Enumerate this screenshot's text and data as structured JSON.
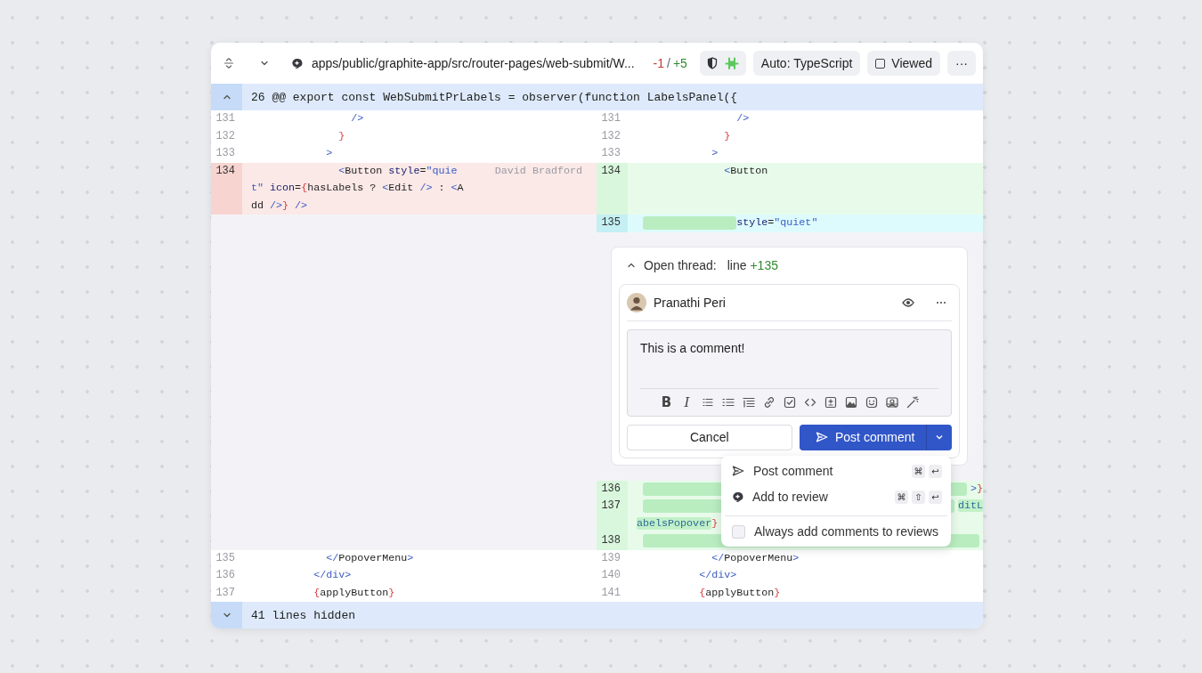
{
  "file_header": {
    "path": "apps/public/graphite-app/src/router-pages/web-submit/W...",
    "deletions": "-1",
    "separator": "/",
    "additions": "+5",
    "language_button": "Auto: TypeScript",
    "viewed": {
      "label": "Viewed",
      "checked": false
    },
    "more": "···"
  },
  "hunk_header": {
    "text": "26 @@ export const WebSubmitPrLabels = observer(function LabelsPanel({",
    "expanded": true
  },
  "pairs": [
    {
      "left": {
        "kind": "context",
        "number": "131",
        "rows": [
          {
            "tokens": [
              {
                "t": "                />",
                "kind": "tag"
              }
            ]
          }
        ]
      },
      "right": {
        "kind": "context",
        "number": "131",
        "rows": [
          {
            "tokens": [
              {
                "t": "                />",
                "kind": "tag"
              }
            ]
          }
        ]
      }
    },
    {
      "left": {
        "kind": "context",
        "number": "132",
        "rows": [
          {
            "tokens": [
              {
                "t": "              }",
                "kind": "brace"
              }
            ]
          }
        ]
      },
      "right": {
        "kind": "context",
        "number": "132",
        "rows": [
          {
            "tokens": [
              {
                "t": "              }",
                "kind": "brace"
              }
            ]
          }
        ]
      }
    },
    {
      "left": {
        "kind": "context",
        "number": "133",
        "rows": [
          {
            "tokens": [
              {
                "t": "            >",
                "kind": "tag"
              }
            ]
          }
        ]
      },
      "right": {
        "kind": "context",
        "number": "133",
        "rows": [
          {
            "tokens": [
              {
                "t": "            >",
                "kind": "tag"
              }
            ]
          }
        ]
      }
    },
    {
      "left": {
        "kind": "removed",
        "number": "134",
        "blame": "David Bradford",
        "rows": [
          {
            "tokens": [
              {
                "t": "              <",
                "kind": "tag"
              },
              {
                "t": "Button ",
                "kind": "text"
              },
              {
                "t": "style",
                "kind": "attr"
              },
              {
                "t": "=",
                "kind": "text"
              },
              {
                "t": "\"quie",
                "kind": "str"
              }
            ]
          },
          {
            "tokens": [
              {
                "t": "t\" ",
                "kind": "str"
              },
              {
                "t": "icon",
                "kind": "attr"
              },
              {
                "t": "=",
                "kind": "text"
              },
              {
                "t": "{",
                "kind": "brace"
              },
              {
                "t": "hasLabels ? ",
                "kind": "text"
              },
              {
                "t": "<",
                "kind": "tag"
              },
              {
                "t": "Edit ",
                "kind": "text"
              },
              {
                "t": "/>",
                "kind": "tag"
              },
              {
                "t": " : ",
                "kind": "text"
              },
              {
                "t": "<",
                "kind": "tag"
              },
              {
                "t": "A",
                "kind": "text"
              }
            ]
          },
          {
            "tokens": [
              {
                "t": "dd ",
                "kind": "text"
              },
              {
                "t": "/>",
                "kind": "tag"
              },
              {
                "t": "}",
                "kind": "brace"
              },
              {
                "t": " />",
                "kind": "tag"
              }
            ]
          }
        ]
      },
      "right": {
        "kind": "added",
        "number": "134",
        "rows": [
          {
            "tokens": [
              {
                "t": "              <",
                "kind": "tag"
              },
              {
                "t": "Button",
                "kind": "text"
              }
            ]
          }
        ]
      }
    },
    {
      "left": {
        "kind": "gap"
      },
      "right": {
        "kind": "current",
        "number": "135",
        "rows": [
          {
            "kind": "indent",
            "tokens": [
              {
                "t": "style",
                "kind": "attr"
              },
              {
                "t": "=",
                "kind": "text"
              },
              {
                "t": "\"quiet\"",
                "kind": "str"
              }
            ]
          }
        ]
      }
    },
    {
      "left": {
        "kind": "gap"
      },
      "right": {
        "kind": "thread",
        "title": "Open thread:",
        "line_label": "line",
        "line_ref": "+135",
        "expanded": true,
        "comment": {
          "author": "Pranathi Peri",
          "text": "This is a comment!",
          "format_buttons": [
            "B",
            "I"
          ],
          "cancel": "Cancel",
          "submit": "Post comment"
        },
        "menu": [
          {
            "kind": "action",
            "label": "Post comment",
            "keys": [
              "⌘",
              "↩"
            ]
          },
          {
            "kind": "action",
            "label": "Add to review",
            "keys": [
              "⌘",
              "⇧",
              "↩"
            ]
          },
          {
            "kind": "checkbox",
            "label": "Always add comments to reviews",
            "checked": false
          }
        ]
      }
    },
    {
      "left": {
        "kind": "gap"
      },
      "right": {
        "kind": "added",
        "number": "136",
        "rows": [
          {
            "kind": "fill",
            "tokens": [
              {
                "t": ">",
                "kind": "tag"
              },
              {
                "t": "}",
                "kind": "brace"
              }
            ]
          }
        ]
      }
    },
    {
      "left": {
        "kind": "gap"
      },
      "right": {
        "kind": "added",
        "number": "137",
        "rows": [
          {
            "kind": "fill",
            "tokens": [
              {
                "t": "ditL",
                "kind": "hl"
              }
            ]
          },
          {
            "tokens": [
              {
                "t": "abelsPopover",
                "kind": "hl"
              },
              {
                "t": "}",
                "kind": "brace"
              }
            ]
          }
        ]
      }
    },
    {
      "left": {
        "kind": "gap"
      },
      "right": {
        "kind": "added",
        "number": "138",
        "rows": [
          {
            "kind": "fill"
          }
        ]
      }
    },
    {
      "left": {
        "kind": "context",
        "number": "135",
        "rows": [
          {
            "tokens": [
              {
                "t": "            </",
                "kind": "tag"
              },
              {
                "t": "PopoverMenu",
                "kind": "text"
              },
              {
                "t": ">",
                "kind": "tag"
              }
            ]
          }
        ]
      },
      "right": {
        "kind": "context",
        "number": "139",
        "rows": [
          {
            "tokens": [
              {
                "t": "            </",
                "kind": "tag"
              },
              {
                "t": "PopoverMenu",
                "kind": "text"
              },
              {
                "t": ">",
                "kind": "tag"
              }
            ]
          }
        ]
      }
    },
    {
      "left": {
        "kind": "context",
        "number": "136",
        "rows": [
          {
            "tokens": [
              {
                "t": "          </div>",
                "kind": "tag"
              }
            ]
          }
        ]
      },
      "right": {
        "kind": "context",
        "number": "140",
        "rows": [
          {
            "tokens": [
              {
                "t": "          </div>",
                "kind": "tag"
              }
            ]
          }
        ]
      }
    },
    {
      "left": {
        "kind": "context",
        "number": "137",
        "rows": [
          {
            "tokens": [
              {
                "t": "          {",
                "kind": "brace"
              },
              {
                "t": "applyButton",
                "kind": "text"
              },
              {
                "t": "}",
                "kind": "brace"
              }
            ]
          }
        ]
      },
      "right": {
        "kind": "context",
        "number": "141",
        "rows": [
          {
            "tokens": [
              {
                "t": "          {",
                "kind": "brace"
              },
              {
                "t": "applyButton",
                "kind": "text"
              },
              {
                "t": "}",
                "kind": "brace"
              }
            ]
          }
        ]
      }
    }
  ],
  "footer": {
    "text": "41 lines hidden",
    "expanded": false
  }
}
